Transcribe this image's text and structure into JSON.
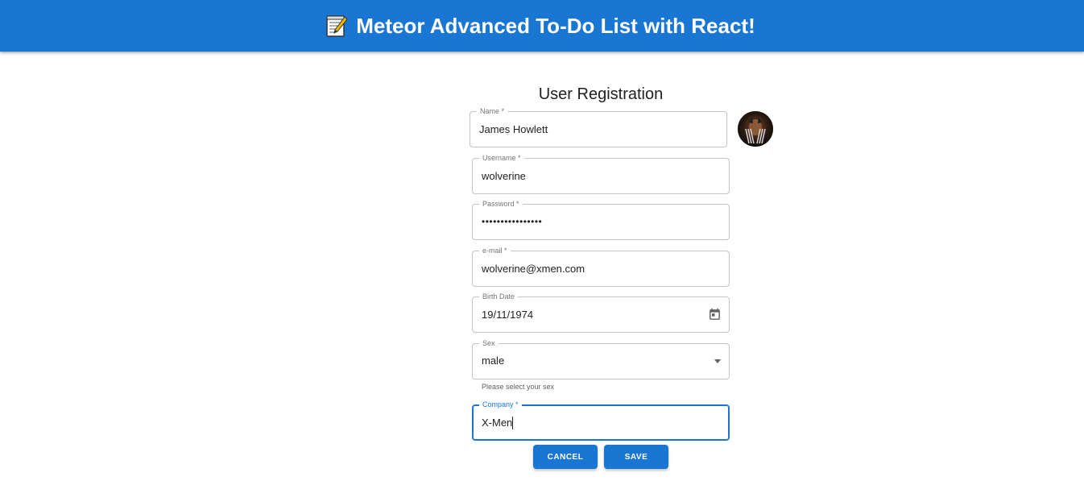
{
  "header": {
    "title": "Meteor Advanced To-Do List with React!",
    "icon": "memo-icon",
    "background": "#1976d2"
  },
  "form": {
    "title": "User Registration",
    "fields": {
      "name": {
        "label": "Name *",
        "value": "James Howlett"
      },
      "username": {
        "label": "Username *",
        "value": "wolverine"
      },
      "password": {
        "label": "Password *",
        "value": "••••••••••••••••"
      },
      "email": {
        "label": "e-mail *",
        "value": "wolverine@xmen.com"
      },
      "birth_date": {
        "label": "Birth Date",
        "value": "19/11/1974",
        "icon": "calendar-icon"
      },
      "sex": {
        "label": "Sex",
        "value": "male",
        "helper": "Please select your sex",
        "icon": "dropdown-arrow-icon"
      },
      "company": {
        "label": "Company *",
        "value": "X-Men"
      }
    },
    "avatar": "user-avatar",
    "buttons": {
      "cancel": "CANCEL",
      "save": "SAVE"
    },
    "accent_color": "#1976d2"
  }
}
